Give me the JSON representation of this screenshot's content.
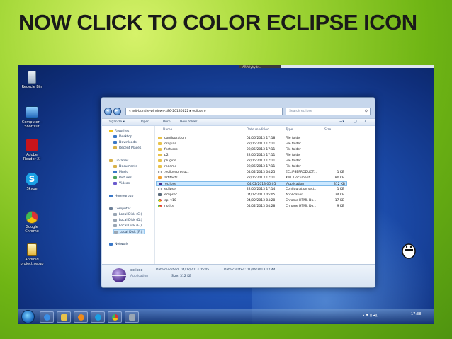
{
  "slide": {
    "title": "NOW CLICK TO COLOR ECLIPSE ICON"
  },
  "desktop": {
    "icons": [
      {
        "label": "Recycle Bin",
        "icon": "recycle-bin-icon"
      },
      {
        "label": "Computer - Shortcut",
        "icon": "computer-icon"
      },
      {
        "label": "Adobe Reader XI",
        "icon": "pdf-icon"
      },
      {
        "label": "Skype",
        "icon": "skype-icon"
      },
      {
        "label": "Google Chrome",
        "icon": "chrome-icon"
      },
      {
        "label": "Android project setup",
        "icon": "shortcut-icon"
      }
    ],
    "top_strip_label": "ARPolyhydr..."
  },
  "explorer": {
    "address": "« adt-bundle-windows-x86-20130522 ▸ eclipse ▸",
    "search_placeholder": "Search eclipse",
    "toolbar": {
      "organize": "Organize ▾",
      "open": "Open",
      "burn": "Burn",
      "new_folder": "New folder"
    },
    "nav": {
      "favorites": "Favorites",
      "desktop": "Desktop",
      "downloads": "Downloads",
      "recent_places": "Recent Places",
      "libraries": "Libraries",
      "documents": "Documents",
      "music": "Music",
      "pictures": "Pictures",
      "videos": "Videos",
      "homegroup": "Homegroup",
      "computer": "Computer",
      "disk_c": "Local Disk (C:)",
      "disk_d": "Local Disk (D:)",
      "disk_e": "Local Disk (E:)",
      "disk_f": "Local Disk (F:)",
      "network": "Network"
    },
    "columns": {
      "name": "Name",
      "date": "Date modified",
      "type": "Type",
      "size": "Size"
    },
    "files": [
      {
        "name": "configuration",
        "date": "01/06/2013 17:18",
        "type": "File folder",
        "size": ""
      },
      {
        "name": "dropins",
        "date": "22/05/2013 17:11",
        "type": "File folder",
        "size": ""
      },
      {
        "name": "features",
        "date": "22/05/2013 17:11",
        "type": "File folder",
        "size": ""
      },
      {
        "name": "p2",
        "date": "22/05/2013 17:11",
        "type": "File folder",
        "size": ""
      },
      {
        "name": "plugins",
        "date": "22/05/2013 17:11",
        "type": "File folder",
        "size": ""
      },
      {
        "name": "readme",
        "date": "22/05/2013 17:11",
        "type": "File folder",
        "size": ""
      },
      {
        "name": ".eclipseproduct",
        "date": "04/02/2013 04:25",
        "type": "ECLIPSEPRODUCT...",
        "size": "1 KB"
      },
      {
        "name": "artifacts",
        "date": "22/05/2013 17:11",
        "type": "XML Document",
        "size": "80 KB"
      },
      {
        "name": "eclipse",
        "date": "04/02/2013 05:05",
        "type": "Application",
        "size": "312 KB"
      },
      {
        "name": "eclipse",
        "date": "22/05/2013 17:14",
        "type": "Configuration sett...",
        "size": "1 KB"
      },
      {
        "name": "eclipsec",
        "date": "04/02/2013 05:05",
        "type": "Application",
        "size": "24 KB"
      },
      {
        "name": "epl-v10",
        "date": "04/02/2013 04:28",
        "type": "Chrome HTML Do...",
        "size": "17 KB"
      },
      {
        "name": "notice",
        "date": "04/02/2013 04:28",
        "type": "Chrome HTML Do...",
        "size": "9 KB"
      }
    ],
    "details": {
      "name": "eclipse",
      "kind": "Application",
      "modified": "Date modified: 04/02/2013 05:05",
      "size": "Size: 312 KB",
      "created": "Date created: 01/06/2013 12:44"
    }
  },
  "taskbar": {
    "clock": "17:38"
  }
}
